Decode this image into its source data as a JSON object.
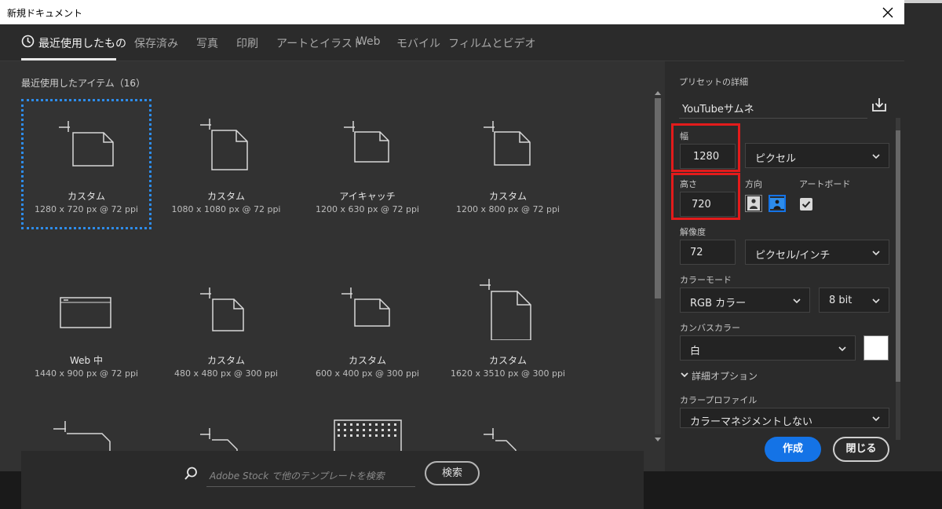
{
  "window": {
    "title": "新規ドキュメント"
  },
  "tabs": [
    {
      "label": "最近使用したもの",
      "active": true
    },
    {
      "label": "保存済み"
    },
    {
      "label": "写真"
    },
    {
      "label": "印刷"
    },
    {
      "label": "アートとイラスト"
    },
    {
      "label": "Web"
    },
    {
      "label": "モバイル"
    },
    {
      "label": "フィルムとビデオ"
    }
  ],
  "recent": {
    "title": "最近使用したアイテム（16）",
    "items": [
      {
        "name": "カスタム",
        "size": "1280 x 720 px @ 72 ppi",
        "icon": "document-icon",
        "selected": true
      },
      {
        "name": "カスタム",
        "size": "1080 x 1080 px @ 72 ppi",
        "icon": "document-icon"
      },
      {
        "name": "アイキャッチ",
        "size": "1200 x 630 px @ 72 ppi",
        "icon": "document-icon"
      },
      {
        "name": "カスタム",
        "size": "1200 x 800 px @ 72 ppi",
        "icon": "document-icon"
      },
      {
        "name": "Web 中",
        "size": "1440 x 900 px @ 72 ppi",
        "icon": "browser-window-icon"
      },
      {
        "name": "カスタム",
        "size": "480 x 480 px @ 300 ppi",
        "icon": "document-icon"
      },
      {
        "name": "カスタム",
        "size": "600 x 400 px @ 300 ppi",
        "icon": "document-icon"
      },
      {
        "name": "カスタム",
        "size": "1620 x 3510 px @ 300 ppi",
        "icon": "tall-document-icon"
      }
    ]
  },
  "search": {
    "placeholder": "Adobe Stock で他のテンプレートを検索",
    "button": "検索",
    "icon": "search-icon"
  },
  "preset": {
    "section_label": "プリセットの詳細",
    "name": "YouTubeサムネ",
    "save_icon": "save-preset-icon",
    "width_label": "幅",
    "width_value": "1280",
    "unit": "ピクセル",
    "height_label": "高さ",
    "height_value": "720",
    "orientation_label": "方向",
    "artboard_label": "アートボード",
    "artboard_checked": true,
    "resolution_label": "解像度",
    "resolution_value": "72",
    "resolution_unit": "ピクセル/インチ",
    "color_mode_label": "カラーモード",
    "color_mode": "RGB カラー",
    "bit_depth": "8 bit",
    "canvas_color_label": "カンバスカラー",
    "canvas_color": "白",
    "canvas_swatch": "#ffffff",
    "advanced_label": "詳細オプション",
    "profile_label": "カラープロファイル",
    "profile_value": "カラーマネジメントしない"
  },
  "buttons": {
    "create": "作成",
    "close": "閉じる"
  },
  "colors": {
    "accent": "#1473e6",
    "highlight": "#e31b1b",
    "selection": "#2d8ceb"
  }
}
